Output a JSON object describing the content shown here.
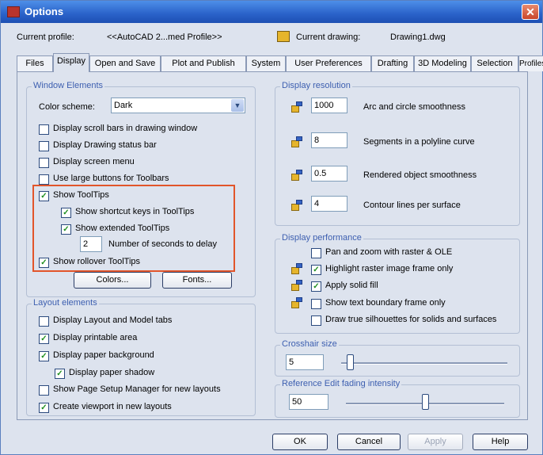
{
  "window": {
    "title": "Options",
    "close_glyph": "✕",
    "current_profile_label": "Current profile:",
    "current_profile_value": "<<AutoCAD 2...med Profile>>",
    "current_drawing_label": "Current drawing:",
    "current_drawing_value": "Drawing1.dwg"
  },
  "tabs": [
    "Files",
    "Display",
    "Open and Save",
    "Plot and Publish",
    "System",
    "User Preferences",
    "Drafting",
    "3D Modeling",
    "Selection",
    "Profiles"
  ],
  "window_elements": {
    "title": "Window Elements",
    "color_scheme_label": "Color scheme:",
    "color_scheme_value": "Dark",
    "checkboxes": [
      {
        "label": "Display scroll bars in drawing window",
        "checked": false
      },
      {
        "label": "Display Drawing status bar",
        "checked": false
      },
      {
        "label": "Display screen menu",
        "checked": false
      },
      {
        "label": "Use large buttons for Toolbars",
        "checked": false
      },
      {
        "label": "Show ToolTips",
        "checked": true
      },
      {
        "label": "Show shortcut keys in ToolTips",
        "checked": true
      },
      {
        "label": "Show extended ToolTips",
        "checked": true
      },
      {
        "label": "Show rollover ToolTips",
        "checked": true
      }
    ],
    "delay_value": "2",
    "delay_label": "Number of seconds to delay",
    "colors_button": "Colors...",
    "fonts_button": "Fonts..."
  },
  "layout_elements": {
    "title": "Layout elements",
    "checkboxes": [
      {
        "label": "Display Layout and Model tabs",
        "checked": false
      },
      {
        "label": "Display printable area",
        "checked": true
      },
      {
        "label": "Display paper background",
        "checked": true
      },
      {
        "label": "Display paper shadow",
        "checked": true
      },
      {
        "label": "Show Page Setup Manager for new layouts",
        "checked": false
      },
      {
        "label": "Create viewport in new layouts",
        "checked": true
      }
    ]
  },
  "display_resolution": {
    "title": "Display resolution",
    "rows": [
      {
        "value": "1000",
        "label": "Arc and circle smoothness"
      },
      {
        "value": "8",
        "label": "Segments in a polyline curve"
      },
      {
        "value": "0.5",
        "label": "Rendered object smoothness"
      },
      {
        "value": "4",
        "label": "Contour lines per surface"
      }
    ]
  },
  "display_performance": {
    "title": "Display performance",
    "checkboxes": [
      {
        "label": "Pan and zoom with raster & OLE",
        "checked": false
      },
      {
        "label": "Highlight raster image frame only",
        "checked": true
      },
      {
        "label": "Apply solid fill",
        "checked": true
      },
      {
        "label": "Show text boundary frame only",
        "checked": false
      },
      {
        "label": "Draw true silhouettes for solids and surfaces",
        "checked": false
      }
    ]
  },
  "crosshair": {
    "title": "Crosshair size",
    "value": "5",
    "level_fraction": 0.05
  },
  "xref_fading": {
    "title": "Reference Edit fading intensity",
    "value": "50",
    "level_fraction": 0.5
  },
  "footer": {
    "ok": "OK",
    "cancel": "Cancel",
    "apply": "Apply",
    "help": "Help"
  },
  "colors": {
    "titlebar": "#2a62c9",
    "group_title": "#3d5fb0",
    "highlight": "#e2552a",
    "check": "#1f8f1f"
  },
  "icons": [
    "app-icon",
    "drawing-icon",
    "pencil-icon",
    "checkmark-icon",
    "dropdown-arrow-icon"
  ]
}
